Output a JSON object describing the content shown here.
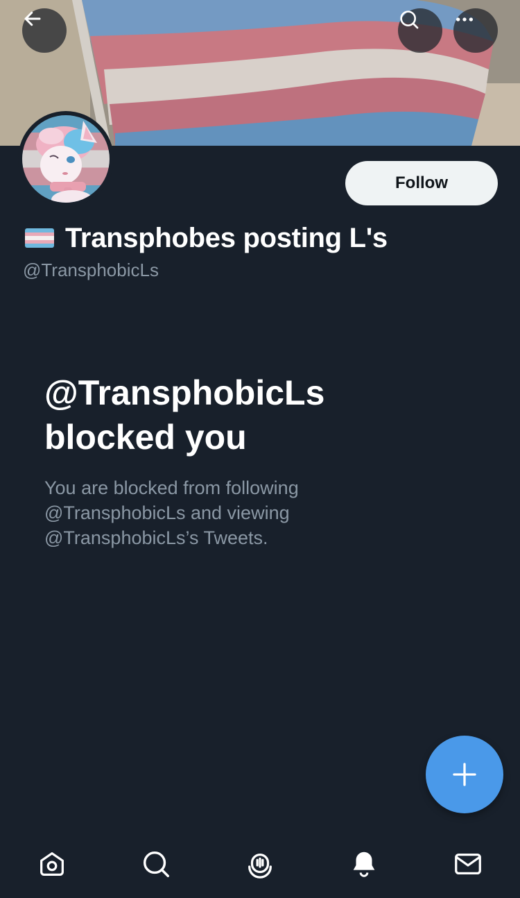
{
  "header": {
    "back_icon": "arrow-left-icon",
    "search_icon": "search-icon",
    "more_icon": "more-horizontal-icon"
  },
  "profile": {
    "display_name": "Transphobes posting L's",
    "name_flag_icon": "transgender-flag-emoji",
    "handle": "@TransphobicLs",
    "follow_label": "Follow"
  },
  "blocked": {
    "title_line1": "@TransphobicLs",
    "title_line2": "blocked you",
    "desc_line1": "You are blocked from following",
    "desc_line2": "@TransphobicLs and viewing",
    "desc_line3": "@TransphobicLs’s Tweets."
  },
  "fab": {
    "icon": "plus-icon"
  },
  "bottom_nav": {
    "items": [
      "home-icon",
      "search-icon",
      "spaces-icon",
      "notifications-icon",
      "messages-icon"
    ]
  },
  "colors": {
    "background": "#18202b",
    "accent": "#4a99e9",
    "secondary_text": "#8b98a5",
    "flag_blue": "#6fb8de",
    "flag_pink": "#e8a9b7",
    "flag_white": "#f5f0f0"
  }
}
